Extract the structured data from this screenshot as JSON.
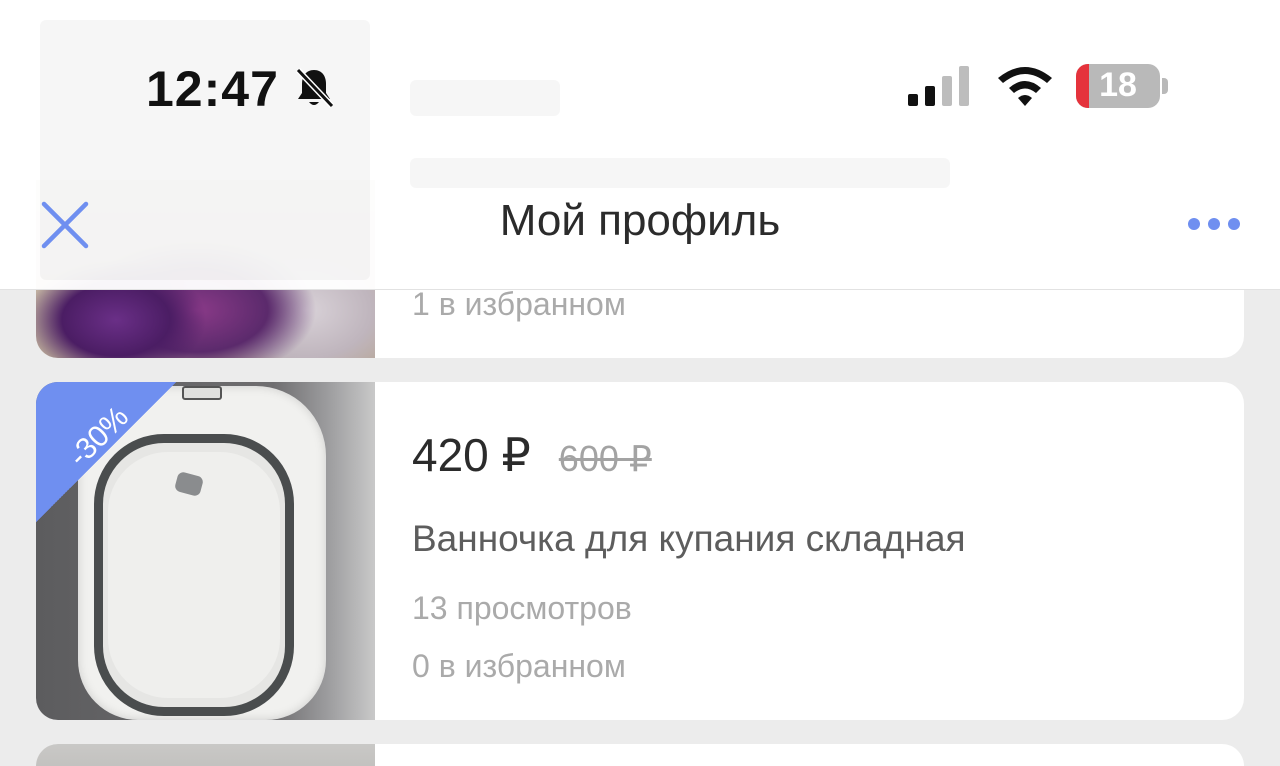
{
  "status_bar": {
    "time": "12:47",
    "battery_level": "18",
    "icons": [
      "bell-slash-icon",
      "cellular-signal-icon",
      "wifi-icon",
      "battery-icon"
    ]
  },
  "nav": {
    "title": "Мой профиль",
    "close_icon": "close-icon",
    "more_icon": "more-dots-icon"
  },
  "listings": [
    {
      "favorites": "1 в избранном"
    },
    {
      "discount_badge": "-30%",
      "price": "420 ₽",
      "old_price": "600 ₽",
      "title": "Ванночка для купания складная",
      "views": "13 просмотров",
      "favorites": "0 в избранном"
    }
  ],
  "colors": {
    "accent": "#6f8ff0",
    "battery_low": "#e5333c",
    "background": "#ececec",
    "card": "#ffffff"
  }
}
